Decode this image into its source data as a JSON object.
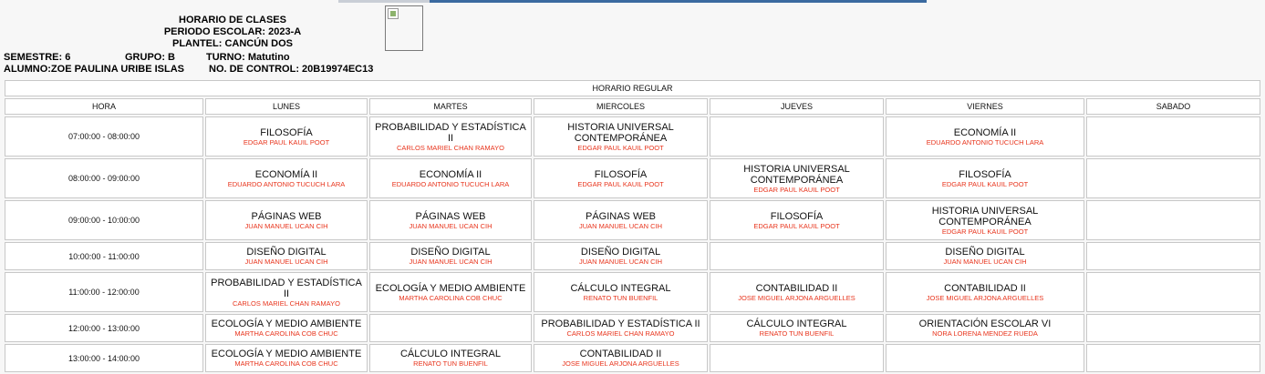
{
  "header": {
    "title": "HORARIO DE CLASES",
    "periodo": "PERIODO ESCOLAR: 2023-A",
    "plantel": "PLANTEL: CANCÚN DOS",
    "semestre": "SEMESTRE: 6",
    "grupo": "GRUPO: B",
    "turno": "TURNO: Matutino",
    "alumno": "ALUMNO:ZOE PAULINA URIBE ISLAS",
    "control": "NO. DE CONTROL: 20B19974EC13"
  },
  "table": {
    "caption": "HORARIO REGULAR",
    "columns": [
      "HORA",
      "LUNES",
      "MARTES",
      "MIERCOLES",
      "JUEVES",
      "VIERNES",
      "SABADO"
    ],
    "rows": [
      {
        "hora": "07:00:00 - 08:00:00",
        "cells": [
          {
            "subject": "FILOSOFÍA",
            "teacher": "EDGAR PAUL KAUIL POOT"
          },
          {
            "subject": "PROBABILIDAD Y ESTADÍSTICA II",
            "teacher": "CARLOS MARIEL CHAN RAMAYO"
          },
          {
            "subject": "HISTORIA UNIVERSAL CONTEMPORÁNEA",
            "teacher": "EDGAR PAUL KAUIL POOT"
          },
          {
            "subject": "",
            "teacher": ""
          },
          {
            "subject": "ECONOMÍA II",
            "teacher": "EDUARDO ANTONIO TUCUCH LARA"
          },
          {
            "subject": "",
            "teacher": ""
          }
        ]
      },
      {
        "hora": "08:00:00 - 09:00:00",
        "cells": [
          {
            "subject": "ECONOMÍA II",
            "teacher": "EDUARDO ANTONIO TUCUCH LARA"
          },
          {
            "subject": "ECONOMÍA II",
            "teacher": "EDUARDO ANTONIO TUCUCH LARA"
          },
          {
            "subject": "FILOSOFÍA",
            "teacher": "EDGAR PAUL KAUIL POOT"
          },
          {
            "subject": "HISTORIA UNIVERSAL CONTEMPORÁNEA",
            "teacher": "EDGAR PAUL KAUIL POOT"
          },
          {
            "subject": "FILOSOFÍA",
            "teacher": "EDGAR PAUL KAUIL POOT"
          },
          {
            "subject": "",
            "teacher": ""
          }
        ]
      },
      {
        "hora": "09:00:00 - 10:00:00",
        "cells": [
          {
            "subject": "PÁGINAS WEB",
            "teacher": "JUAN MANUEL UCAN CIH"
          },
          {
            "subject": "PÁGINAS WEB",
            "teacher": "JUAN MANUEL UCAN CIH"
          },
          {
            "subject": "PÁGINAS WEB",
            "teacher": "JUAN MANUEL UCAN CIH"
          },
          {
            "subject": "FILOSOFÍA",
            "teacher": "EDGAR PAUL KAUIL POOT"
          },
          {
            "subject": "HISTORIA UNIVERSAL CONTEMPORÁNEA",
            "teacher": "EDGAR PAUL KAUIL POOT"
          },
          {
            "subject": "",
            "teacher": ""
          }
        ]
      },
      {
        "hora": "10:00:00 - 11:00:00",
        "cells": [
          {
            "subject": "DISEÑO DIGITAL",
            "teacher": "JUAN MANUEL UCAN CIH"
          },
          {
            "subject": "DISEÑO DIGITAL",
            "teacher": "JUAN MANUEL UCAN CIH"
          },
          {
            "subject": "DISEÑO DIGITAL",
            "teacher": "JUAN MANUEL UCAN CIH"
          },
          {
            "subject": "",
            "teacher": ""
          },
          {
            "subject": "DISEÑO DIGITAL",
            "teacher": "JUAN MANUEL UCAN CIH"
          },
          {
            "subject": "",
            "teacher": ""
          }
        ]
      },
      {
        "hora": "11:00:00 - 12:00:00",
        "cells": [
          {
            "subject": "PROBABILIDAD Y ESTADÍSTICA II",
            "teacher": "CARLOS MARIEL CHAN RAMAYO"
          },
          {
            "subject": "ECOLOGÍA Y MEDIO AMBIENTE",
            "teacher": "MARTHA CAROLINA COB CHUC"
          },
          {
            "subject": "CÁLCULO INTEGRAL",
            "teacher": "RENATO TUN BUENFIL"
          },
          {
            "subject": "CONTABILIDAD II",
            "teacher": "JOSE MIGUEL ARJONA ARGUELLES"
          },
          {
            "subject": "CONTABILIDAD II",
            "teacher": "JOSE MIGUEL ARJONA ARGUELLES"
          },
          {
            "subject": "",
            "teacher": ""
          }
        ]
      },
      {
        "hora": "12:00:00 - 13:00:00",
        "cells": [
          {
            "subject": "ECOLOGÍA Y MEDIO AMBIENTE",
            "teacher": "MARTHA CAROLINA COB CHUC"
          },
          {
            "subject": "",
            "teacher": ""
          },
          {
            "subject": "PROBABILIDAD Y ESTADÍSTICA II",
            "teacher": "CARLOS MARIEL CHAN RAMAYO"
          },
          {
            "subject": "CÁLCULO INTEGRAL",
            "teacher": "RENATO TUN BUENFIL"
          },
          {
            "subject": "ORIENTACIÓN ESCOLAR VI",
            "teacher": "NORA LORENA MENDEZ RUEDA"
          },
          {
            "subject": "",
            "teacher": ""
          }
        ]
      },
      {
        "hora": "13:00:00 - 14:00:00",
        "cells": [
          {
            "subject": "ECOLOGÍA Y MEDIO AMBIENTE",
            "teacher": "MARTHA CAROLINA COB CHUC"
          },
          {
            "subject": "CÁLCULO INTEGRAL",
            "teacher": "RENATO TUN BUENFIL"
          },
          {
            "subject": "CONTABILIDAD II",
            "teacher": "JOSE MIGUEL ARJONA ARGUELLES"
          },
          {
            "subject": "",
            "teacher": ""
          },
          {
            "subject": "",
            "teacher": ""
          },
          {
            "subject": "",
            "teacher": ""
          }
        ]
      }
    ]
  }
}
